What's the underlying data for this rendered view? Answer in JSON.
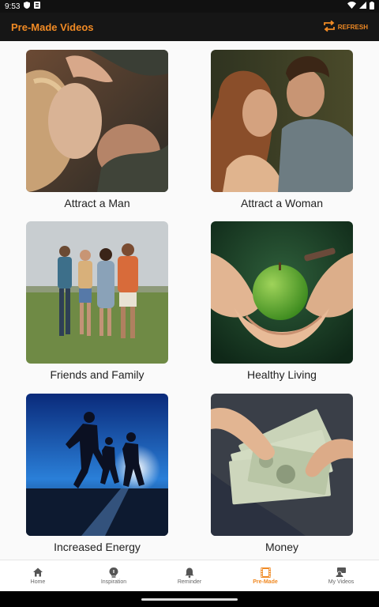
{
  "status_bar": {
    "time": "9:53"
  },
  "app_bar": {
    "title": "Pre-Made Videos",
    "refresh_label": "REFRESH",
    "accent": "#f08a24"
  },
  "cards": [
    {
      "label": "Attract a Man"
    },
    {
      "label": "Attract a Woman"
    },
    {
      "label": "Friends and Family"
    },
    {
      "label": "Healthy Living"
    },
    {
      "label": "Increased Energy"
    },
    {
      "label": "Money"
    }
  ],
  "nav": [
    {
      "label": "Home",
      "icon": "home-icon"
    },
    {
      "label": "Inspiration",
      "icon": "bulb-icon"
    },
    {
      "label": "Reminder",
      "icon": "bell-icon"
    },
    {
      "label": "Pre-Made",
      "icon": "film-icon",
      "active": true
    },
    {
      "label": "My Videos",
      "icon": "user-video-icon"
    }
  ]
}
